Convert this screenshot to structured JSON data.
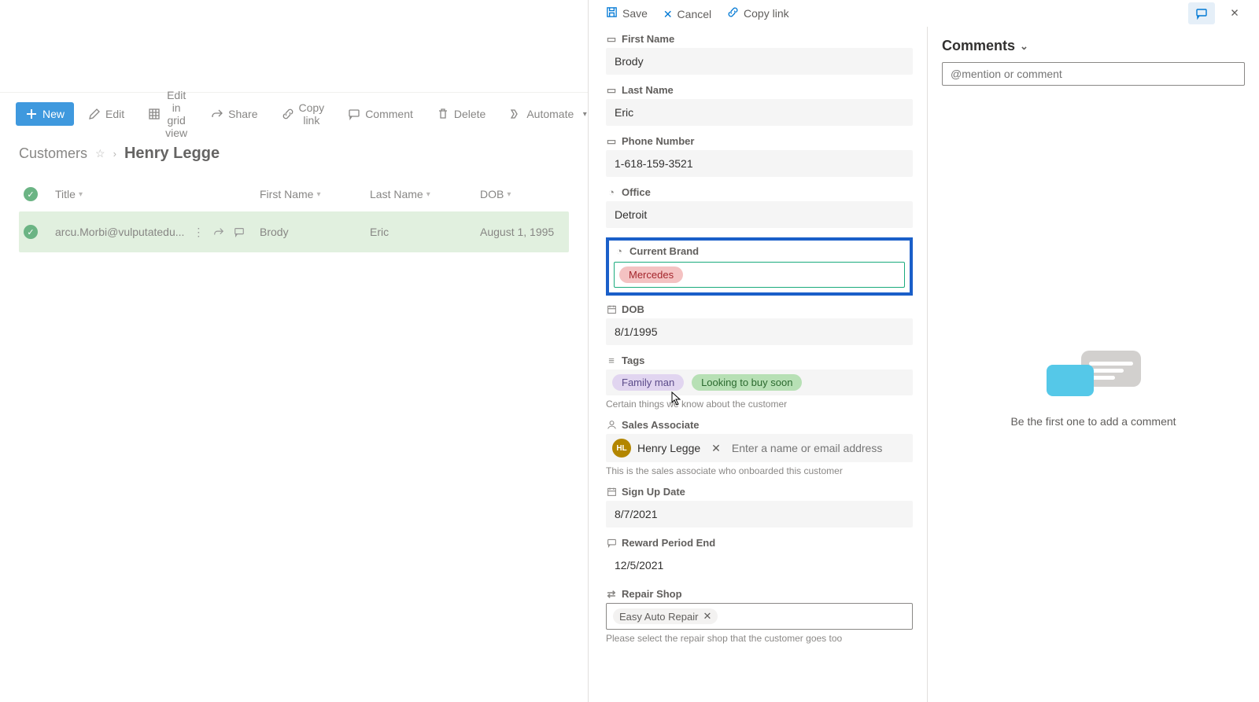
{
  "toolbar": {
    "new_label": "New",
    "edit_label": "Edit",
    "edit_grid_label": "Edit in grid view",
    "share_label": "Share",
    "copylink_label": "Copy link",
    "comment_label": "Comment",
    "delete_label": "Delete",
    "automate_label": "Automate"
  },
  "breadcrumb": {
    "root": "Customers",
    "current": "Henry Legge"
  },
  "table": {
    "columns": [
      "Title",
      "First Name",
      "Last Name",
      "DOB"
    ],
    "rows": [
      {
        "title": "arcu.Morbi@vulputatedu...",
        "first_name": "Brody",
        "last_name": "Eric",
        "dob": "August 1, 1995"
      }
    ]
  },
  "panel_actions": {
    "save_label": "Save",
    "cancel_label": "Cancel",
    "copylink_label": "Copy link"
  },
  "form": {
    "first_name": {
      "label": "First Name",
      "value": "Brody"
    },
    "last_name": {
      "label": "Last Name",
      "value": "Eric"
    },
    "phone": {
      "label": "Phone Number",
      "value": "1-618-159-3521"
    },
    "office": {
      "label": "Office",
      "value": "Detroit"
    },
    "current_brand": {
      "label": "Current Brand",
      "value": "Mercedes"
    },
    "dob": {
      "label": "DOB",
      "value": "8/1/1995"
    },
    "tags": {
      "label": "Tags",
      "values": [
        "Family man",
        "Looking to buy soon"
      ],
      "help": "Certain things we know about the customer"
    },
    "sales_associate": {
      "label": "Sales Associate",
      "person_name": "Henry Legge",
      "person_initials": "HL",
      "placeholder": "Enter a name or email address",
      "help": "This is the sales associate who onboarded this customer"
    },
    "signup": {
      "label": "Sign Up Date",
      "value": "8/7/2021"
    },
    "reward_end": {
      "label": "Reward Period End",
      "value": "12/5/2021"
    },
    "repair_shop": {
      "label": "Repair Shop",
      "value": "Easy Auto Repair",
      "help": "Please select the repair shop that the customer goes too"
    }
  },
  "comments": {
    "header": "Comments",
    "placeholder": "@mention or comment",
    "empty_text": "Be the first one to add a comment"
  }
}
